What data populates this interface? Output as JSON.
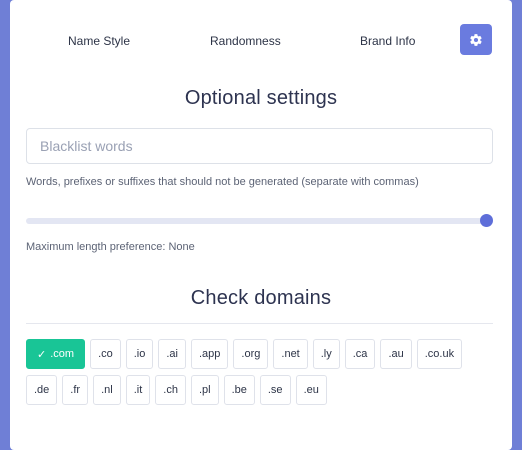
{
  "tabs": [
    {
      "label": "Name Style"
    },
    {
      "label": "Randomness"
    },
    {
      "label": "Brand Info"
    }
  ],
  "settings_icon": "gear-icon",
  "optional": {
    "title": "Optional settings",
    "blacklist_placeholder": "Blacklist words",
    "blacklist_value": "",
    "blacklist_help": "Words, prefixes or suffixes that should not be generated (separate with commas)",
    "max_length_label": "Maximum length preference: None",
    "max_length_fraction": 1.0
  },
  "domains": {
    "title": "Check domains",
    "row1": [
      {
        "label": ".com",
        "selected": true
      },
      {
        "label": ".co",
        "selected": false
      },
      {
        "label": ".io",
        "selected": false
      },
      {
        "label": ".ai",
        "selected": false
      },
      {
        "label": ".app",
        "selected": false
      },
      {
        "label": ".org",
        "selected": false
      },
      {
        "label": ".net",
        "selected": false
      },
      {
        "label": ".ly",
        "selected": false
      },
      {
        "label": ".ca",
        "selected": false
      },
      {
        "label": ".au",
        "selected": false
      },
      {
        "label": ".co.uk",
        "selected": false
      }
    ],
    "row2": [
      {
        "label": ".de",
        "selected": false
      },
      {
        "label": ".fr",
        "selected": false
      },
      {
        "label": ".nl",
        "selected": false
      },
      {
        "label": ".it",
        "selected": false
      },
      {
        "label": ".ch",
        "selected": false
      },
      {
        "label": ".pl",
        "selected": false
      },
      {
        "label": ".be",
        "selected": false
      },
      {
        "label": ".se",
        "selected": false
      },
      {
        "label": ".eu",
        "selected": false
      }
    ]
  },
  "colors": {
    "background": "#6f7fd6",
    "accent": "#6a7bdf",
    "selected_chip": "#19c596",
    "slider_thumb": "#5e6ed9"
  }
}
